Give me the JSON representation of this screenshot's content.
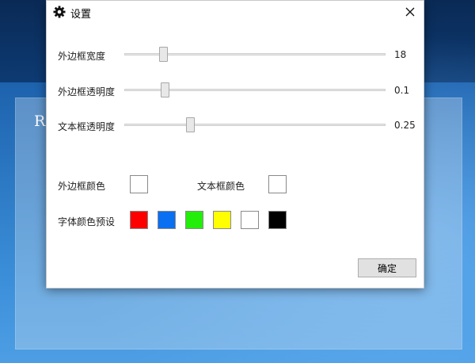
{
  "background": {
    "partial_text": "Ri"
  },
  "dialog": {
    "title": "设置",
    "icons": {
      "title": "gear-icon",
      "close": "close-icon"
    },
    "sliders": [
      {
        "label": "外边框宽度",
        "value": "18",
        "fraction": 0.09
      },
      {
        "label": "外边框透明度",
        "value": "0.1",
        "fraction": 0.1
      },
      {
        "label": "文本框透明度",
        "value": "0.25",
        "fraction": 0.25
      }
    ],
    "border_color_label": "外边框颜色",
    "border_color_value": "#ffffff",
    "text_color_label": "文本框颜色",
    "text_color_value": "#ffffff",
    "font_presets_label": "字体颜色预设",
    "font_presets": [
      "#ff0000",
      "#0a6ff0",
      "#22ee0a",
      "#ffff00",
      "#ffffff",
      "#000000"
    ],
    "ok_label": "确定"
  }
}
